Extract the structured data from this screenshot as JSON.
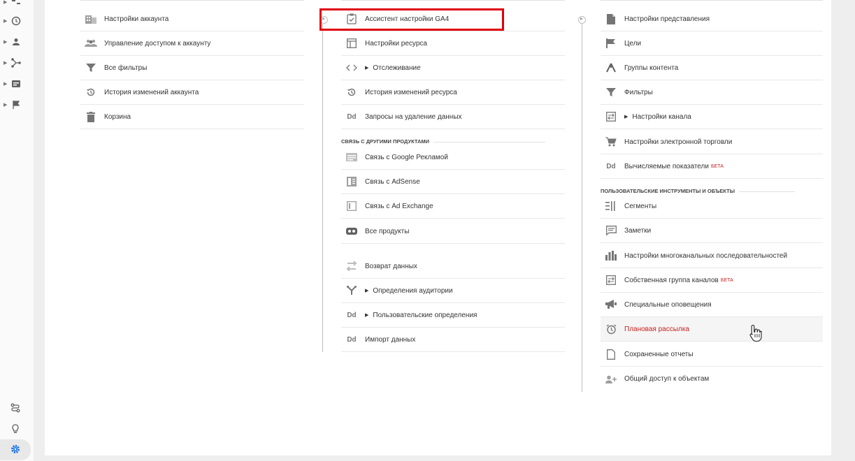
{
  "account": {
    "items": [
      {
        "label": "Настройки аккаунта",
        "icon": "building-icon"
      },
      {
        "label": "Управление доступом к аккаунту",
        "icon": "people-icon"
      },
      {
        "label": "Все фильтры",
        "icon": "filter-icon"
      },
      {
        "label": "История изменений аккаунта",
        "icon": "history-icon"
      },
      {
        "label": "Корзина",
        "icon": "trash-icon"
      }
    ]
  },
  "property": {
    "items": [
      {
        "label": "Ассистент настройки GA4",
        "icon": "checklist-icon"
      },
      {
        "label": "Настройки ресурса",
        "icon": "layout-icon"
      },
      {
        "label": "Отслеживание",
        "icon": "code-icon"
      },
      {
        "label": "История изменений ресурса",
        "icon": "history-icon"
      },
      {
        "label": "Запросы на удаление данных",
        "icon": "dd-icon",
        "icon_text": "Dd"
      }
    ],
    "section_label": "СВЯЗЬ С ДРУГИМИ ПРОДУКТАМИ",
    "links": [
      {
        "label": "Связь с Google Рекламой",
        "icon": "ads-icon"
      },
      {
        "label": "Связь с AdSense",
        "icon": "adsense-icon"
      },
      {
        "label": "Связь с Ad Exchange",
        "icon": "adexchange-icon"
      },
      {
        "label": "Все продукты",
        "icon": "products-icon"
      }
    ],
    "more": [
      {
        "label": "Возврат данных",
        "icon": "swap-icon"
      },
      {
        "label": "Определения аудитории",
        "icon": "audience-icon"
      },
      {
        "label": "Пользовательские определения",
        "icon": "dd-icon",
        "icon_text": "Dd"
      },
      {
        "label": "Импорт данных",
        "icon": "dd-icon",
        "icon_text": "Dd"
      }
    ]
  },
  "view": {
    "items": [
      {
        "label": "Настройки представления",
        "icon": "document-icon"
      },
      {
        "label": "Цели",
        "icon": "flag-icon"
      },
      {
        "label": "Группы контента",
        "icon": "content-group-icon"
      },
      {
        "label": "Фильтры",
        "icon": "filter-icon"
      },
      {
        "label": "Настройки канала",
        "icon": "channel-icon"
      },
      {
        "label": "Настройки электронной торговли",
        "icon": "cart-icon"
      },
      {
        "label": "Вычисляемые показатели",
        "icon": "dd-icon",
        "icon_text": "Dd",
        "badge": "БЕТА"
      }
    ],
    "section_label": "ПОЛЬЗОВАТЕЛЬСКИЕ ИНСТРУМЕНТЫ И ОБЪЕКТЫ",
    "tools": [
      {
        "label": "Сегменты",
        "icon": "segments-icon"
      },
      {
        "label": "Заметки",
        "icon": "notes-icon"
      },
      {
        "label": "Настройки многоканальных последовательностей",
        "icon": "bars-icon"
      },
      {
        "label": "Собственная группа каналов",
        "icon": "channel-group-icon",
        "badge": "БЕТА"
      },
      {
        "label": "Специальные оповещения",
        "icon": "megaphone-icon"
      },
      {
        "label": "Плановая рассылка",
        "icon": "alarm-icon"
      },
      {
        "label": "Сохраненные отчеты",
        "icon": "saved-report-icon"
      },
      {
        "label": "Общий доступ к объектам",
        "icon": "share-user-icon"
      }
    ]
  },
  "leftnav": {
    "items": [
      "dashboard-icon",
      "clock-icon",
      "person-icon",
      "acquisition-icon",
      "behavior-icon",
      "flag-icon"
    ],
    "bottom": [
      "route-icon",
      "lightbulb-icon",
      "gear-icon"
    ]
  },
  "colors": {
    "accent_red": "#e0000d",
    "hover_text": "#c5221f",
    "active_gear": "#1a73e8"
  }
}
